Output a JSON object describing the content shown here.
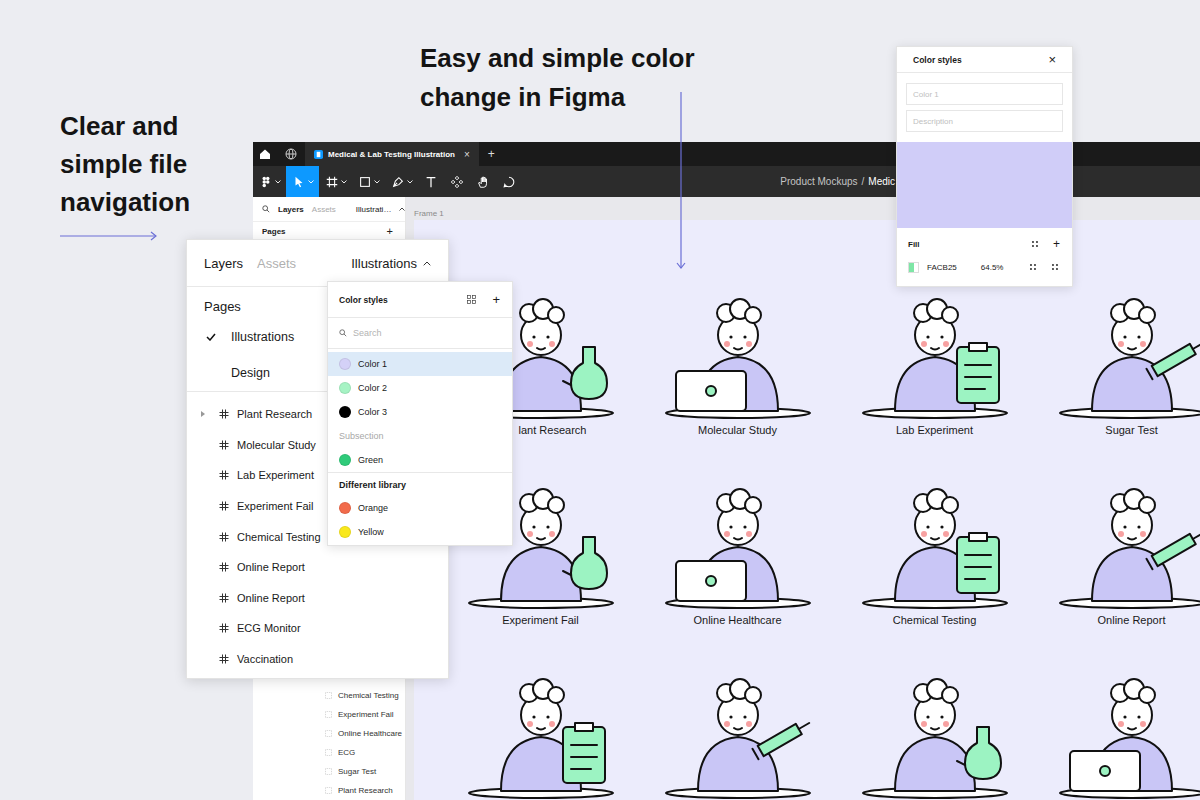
{
  "callouts": {
    "navigation": "Clear and simple file navigation",
    "color_change": "Easy and simple color change in Figma"
  },
  "window": {
    "tab_title": "Medical & Lab Testing Illustration",
    "tab_close": "×",
    "new_tab": "+",
    "breadcrumb": {
      "project": "Product Mockups",
      "separator": "/",
      "file": "Medic"
    }
  },
  "toolbar": {
    "tools": [
      {
        "kind": "menu",
        "selected": false
      },
      {
        "kind": "move",
        "selected": true
      },
      {
        "kind": "frame",
        "selected": false
      },
      {
        "kind": "shape",
        "selected": false
      },
      {
        "kind": "pen",
        "selected": false
      },
      {
        "kind": "text",
        "selected": false
      },
      {
        "kind": "components",
        "selected": false
      },
      {
        "kind": "hand",
        "selected": false
      },
      {
        "kind": "comment",
        "selected": false
      }
    ]
  },
  "left_panel": {
    "tabs": [
      {
        "label": "Layers",
        "selected": true
      },
      {
        "label": "Assets",
        "selected": false
      }
    ],
    "page_menu": "Illustrati…",
    "pages_title": "Pages",
    "add": "+",
    "layers": [
      "Chemical Testing",
      "Experiment Fail",
      "Online Healthcare",
      "ECG",
      "Sugar Test",
      "Plant Research"
    ]
  },
  "canvas": {
    "frame_label": "Frame 1",
    "illustrations": [
      {
        "label": "lant Research"
      },
      {
        "label": "Molecular Study"
      },
      {
        "label": "Lab Experiment"
      },
      {
        "label": "Sugar Test"
      },
      {
        "label": "Experiment Fail"
      },
      {
        "label": "Online Healthcare"
      },
      {
        "label": "Chemical Testing"
      },
      {
        "label": "Online Report"
      }
    ]
  },
  "layers_overlay": {
    "tabs": [
      {
        "label": "Layers",
        "selected": true
      },
      {
        "label": "Assets",
        "selected": false
      }
    ],
    "page_menu": "Illustrations",
    "pages_title": "Pages",
    "pages": [
      {
        "label": "Illustrations",
        "selected": true
      },
      {
        "label": "Design",
        "selected": false
      }
    ],
    "frames": [
      {
        "label": "Plant Research",
        "kind": "group"
      },
      {
        "label": "Molecular Study",
        "kind": "frame"
      },
      {
        "label": "Lab Experiment",
        "kind": "frame"
      },
      {
        "label": "Experiment Fail",
        "kind": "frame"
      },
      {
        "label": "Chemical Testing",
        "kind": "frame"
      },
      {
        "label": "Online Report",
        "kind": "frame"
      },
      {
        "label": "Online Report",
        "kind": "frame"
      },
      {
        "label": "ECG Monitor",
        "kind": "frame"
      },
      {
        "label": "Vaccination",
        "kind": "frame"
      }
    ]
  },
  "color_styles_popup": {
    "title": "Color styles",
    "add": "+",
    "search_placeholder": "Search",
    "items": [
      {
        "kind": "style",
        "label": "Color 1",
        "color": "#d4d1f7",
        "selected": true
      },
      {
        "kind": "style",
        "label": "Color 2",
        "color": "#a6f3c4",
        "selected": false
      },
      {
        "kind": "style",
        "label": "Color 3",
        "color": "#000000",
        "selected": false
      },
      {
        "kind": "subheading",
        "label": "Subsection",
        "selected": false
      },
      {
        "kind": "style",
        "label": "Green",
        "color": "#2fcb7a",
        "selected": false
      },
      {
        "kind": "heading",
        "label": "Different library",
        "selected": false
      },
      {
        "kind": "style",
        "label": "Orange",
        "color": "#f26b4b",
        "selected": false
      },
      {
        "kind": "style",
        "label": "Yellow",
        "color": "#f9e81c",
        "selected": false
      }
    ]
  },
  "color_style_editor": {
    "title": "Color styles",
    "close": "×",
    "name_placeholder": "Color 1",
    "description_placeholder": "Description",
    "fill_title": "Fill",
    "add": "+",
    "fill": {
      "hex": "FACB25",
      "opacity": "64.5%"
    }
  }
}
